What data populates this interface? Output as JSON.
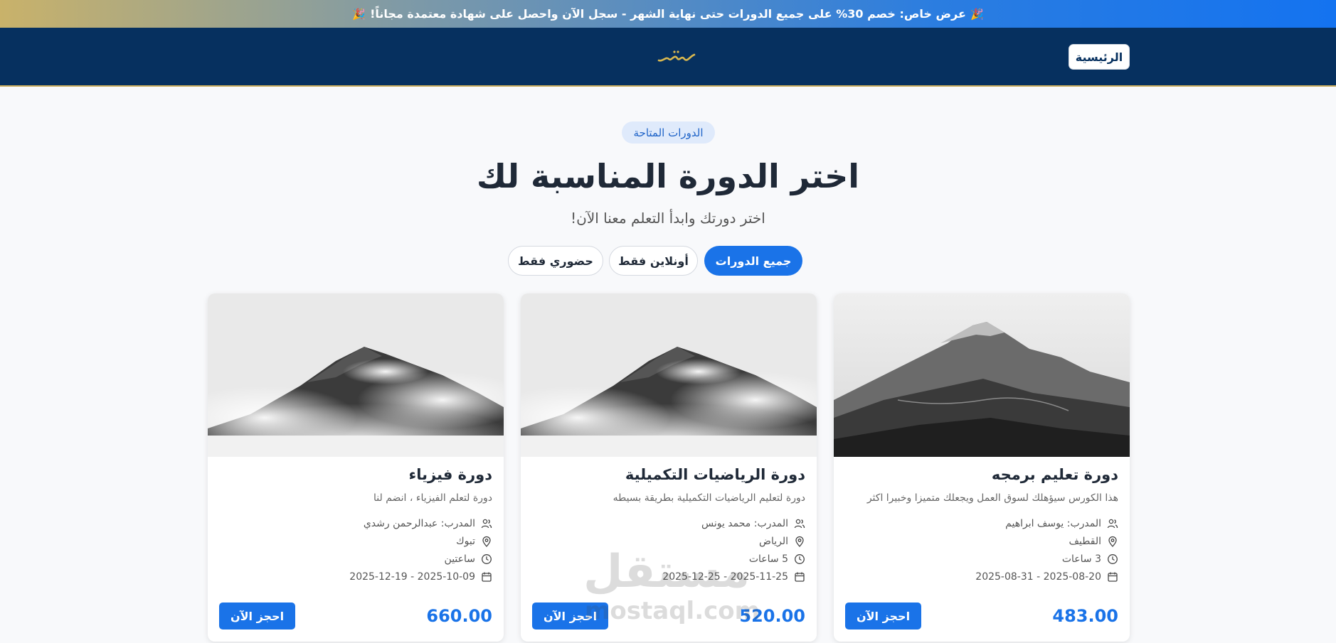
{
  "promo": {
    "text": "عرض خاص: خصم 30% على جميع الدورات حتى نهاية الشهر - سجل الآن واحصل على شهادة معتمدة مجاناً!",
    "emoji": "🎉"
  },
  "nav": {
    "home_label": "الرئيسية",
    "logo_text": "سنمل"
  },
  "hero": {
    "badge": "الدورات المتاحة",
    "title": "اختر الدورة المناسبة لك",
    "subtitle": "اختر دورتك وابدأ التعلم معنا الآن!"
  },
  "filters": [
    {
      "label": "جميع الدورات",
      "active": true
    },
    {
      "label": "أونلاين فقط",
      "active": false
    },
    {
      "label": "حضوري فقط",
      "active": false
    }
  ],
  "courses": [
    {
      "title": "دورة تعليم برمجه",
      "description": "هذا الكورس سيؤهلك لسوق العمل ويجعلك متميزا وخبيرا اكثر",
      "trainer": "المدرب: يوسف ابراهيم",
      "location": "القطيف",
      "duration": "3 ساعات",
      "dates": "2025-08-20 - 2025-08-31",
      "price": "483.00",
      "book_label": "احجز الآن",
      "image": "mountain-photo"
    },
    {
      "title": "دورة الرياضيات التكميلية",
      "description": "دورة لتعليم الرياضيات التكميلية بطريقة بسيطه",
      "trainer": "المدرب: محمد يونس",
      "location": "الرياض",
      "duration": "5 ساعات",
      "dates": "2025-11-25 - 2025-12-25",
      "price": "520.00",
      "book_label": "احجز الآن",
      "image": "cloudy-peak-photo"
    },
    {
      "title": "دورة فيزياء",
      "description": "دورة لتعلم الفيزياء ، انضم لنا",
      "trainer": "المدرب: عبدالرحمن رشدي",
      "location": "تبوك",
      "duration": "ساعتين",
      "dates": "2025-10-09 - 2025-12-19",
      "price": "660.00",
      "book_label": "احجز الآن",
      "image": "cloudy-peak-photo"
    }
  ],
  "watermark": {
    "arabic": "مستقل",
    "latin": "mostaql.com"
  },
  "colors": {
    "primary": "#1a73e8",
    "navbar": "#06305f",
    "gold": "#c8ab5c"
  }
}
